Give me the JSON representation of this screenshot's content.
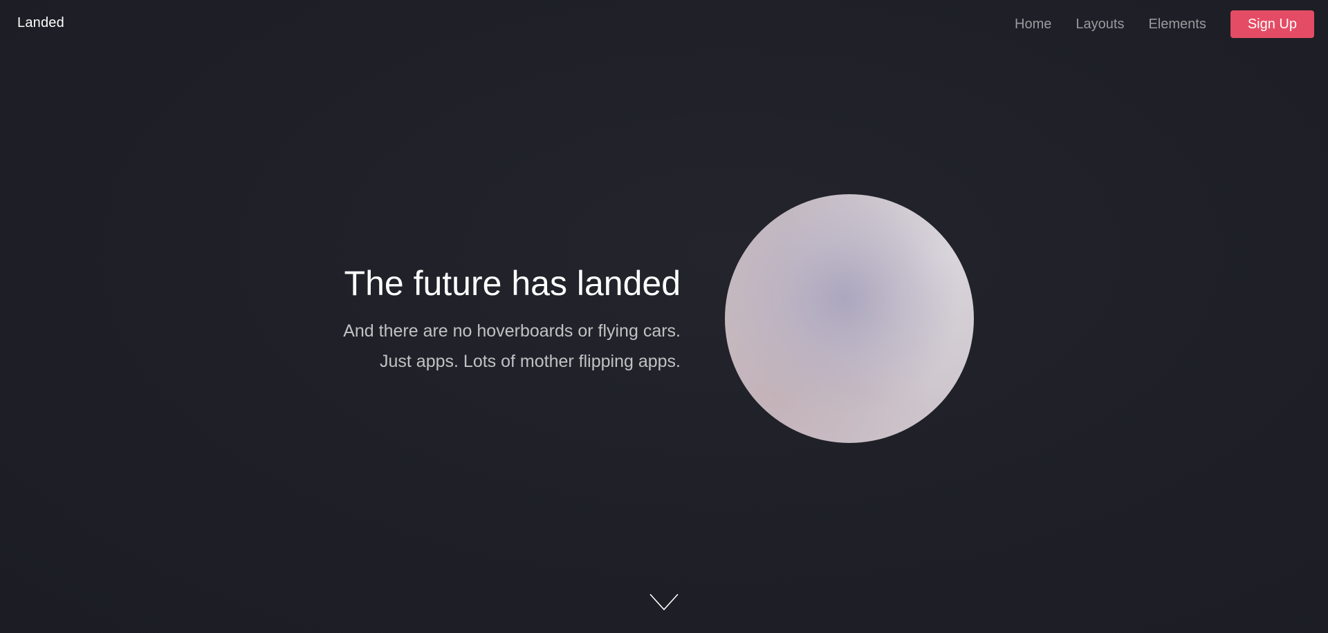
{
  "header": {
    "logo": "Landed",
    "nav": {
      "items": [
        {
          "label": "Home"
        },
        {
          "label": "Layouts"
        },
        {
          "label": "Elements"
        }
      ],
      "signup_label": "Sign Up"
    }
  },
  "hero": {
    "title": "The future has landed",
    "subtitle_lines": [
      "And there are no hoverboards or flying cars.",
      "Just apps. Lots of mother flipping apps."
    ]
  },
  "icons": {
    "scroll": "chevron-down-icon"
  },
  "colors": {
    "background": "#1e1f27",
    "accent": "#e44c65",
    "text": "#ffffff"
  }
}
